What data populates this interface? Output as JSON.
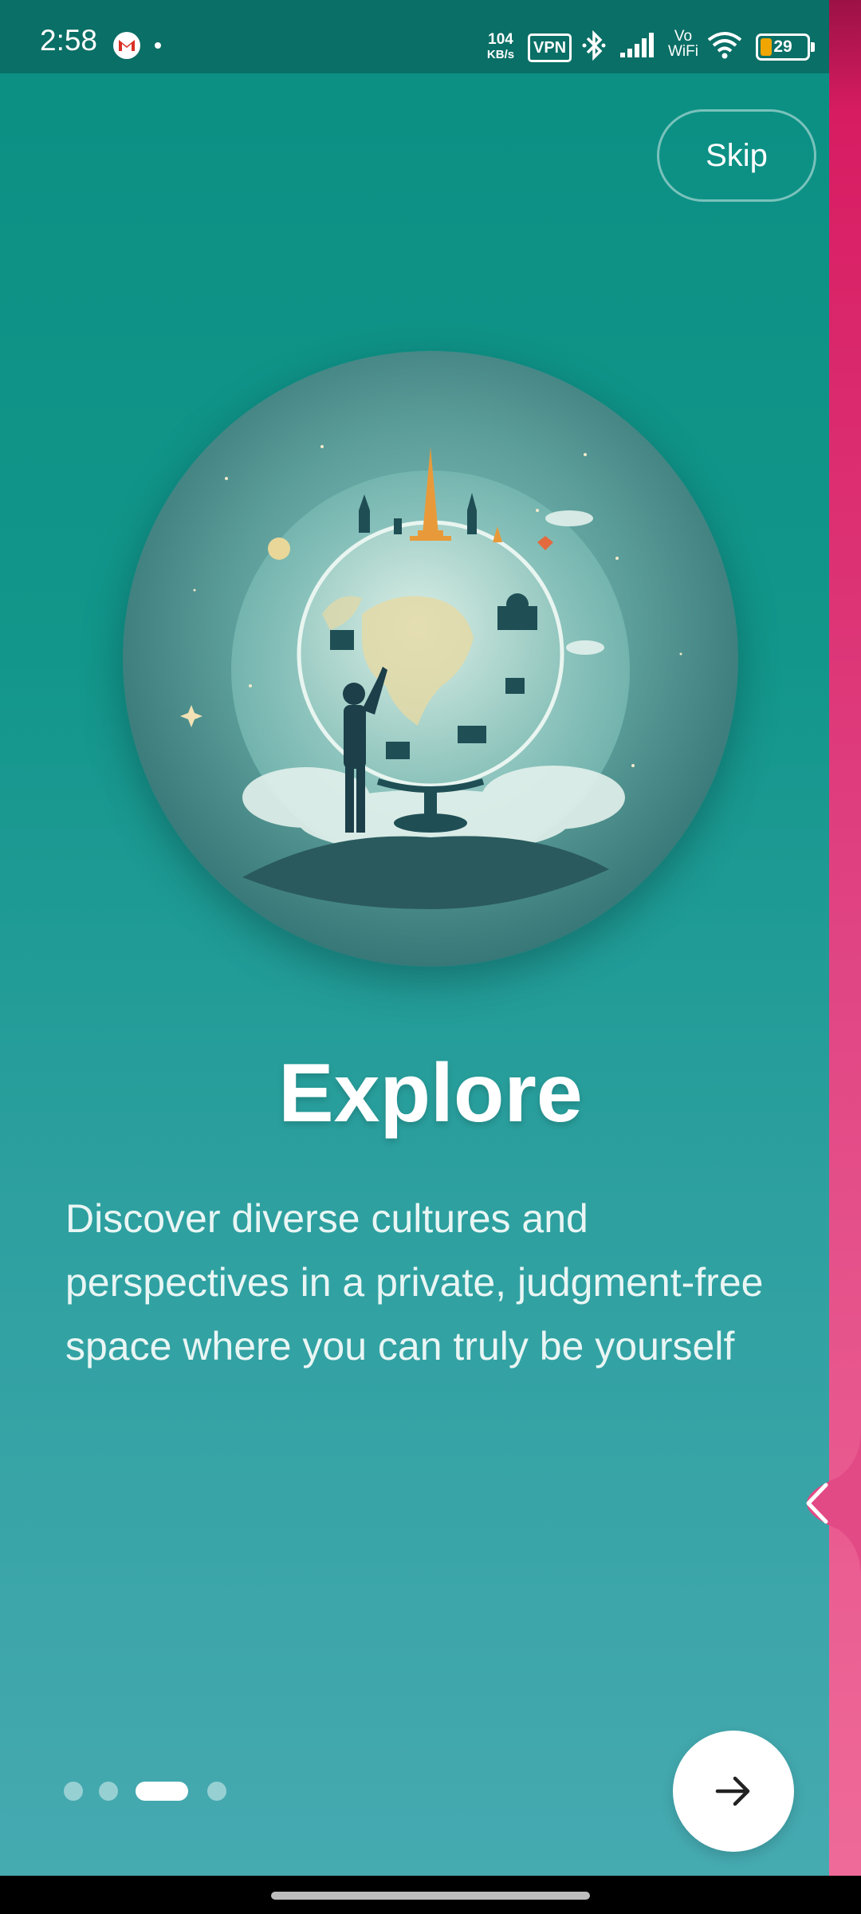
{
  "status_bar": {
    "time": "2:58",
    "speed_top": "104",
    "speed_bottom": "KB/s",
    "vpn": "VPN",
    "vowifi_top": "Vo",
    "vowifi_bottom": "WiFi",
    "battery": "29",
    "battery_level_percent": 29,
    "icons": [
      "gmail-icon",
      "bluetooth-icon",
      "signal-icon",
      "wifi-icon",
      "battery-icon"
    ]
  },
  "header": {
    "skip_label": "Skip"
  },
  "content": {
    "title": "Explore",
    "description": "Discover diverse cultures and perspectives in a private, judgment-free space where you can truly be yourself"
  },
  "pager": {
    "count": 4,
    "active_index": 2
  },
  "colors": {
    "background_top": "#0b8f83",
    "background_bottom": "#46aab1",
    "accent_pink": "#e04483",
    "battery_fill": "#f0a500"
  },
  "icons": {
    "next": "arrow-right-icon",
    "back_tab": "chevron-left-icon"
  }
}
